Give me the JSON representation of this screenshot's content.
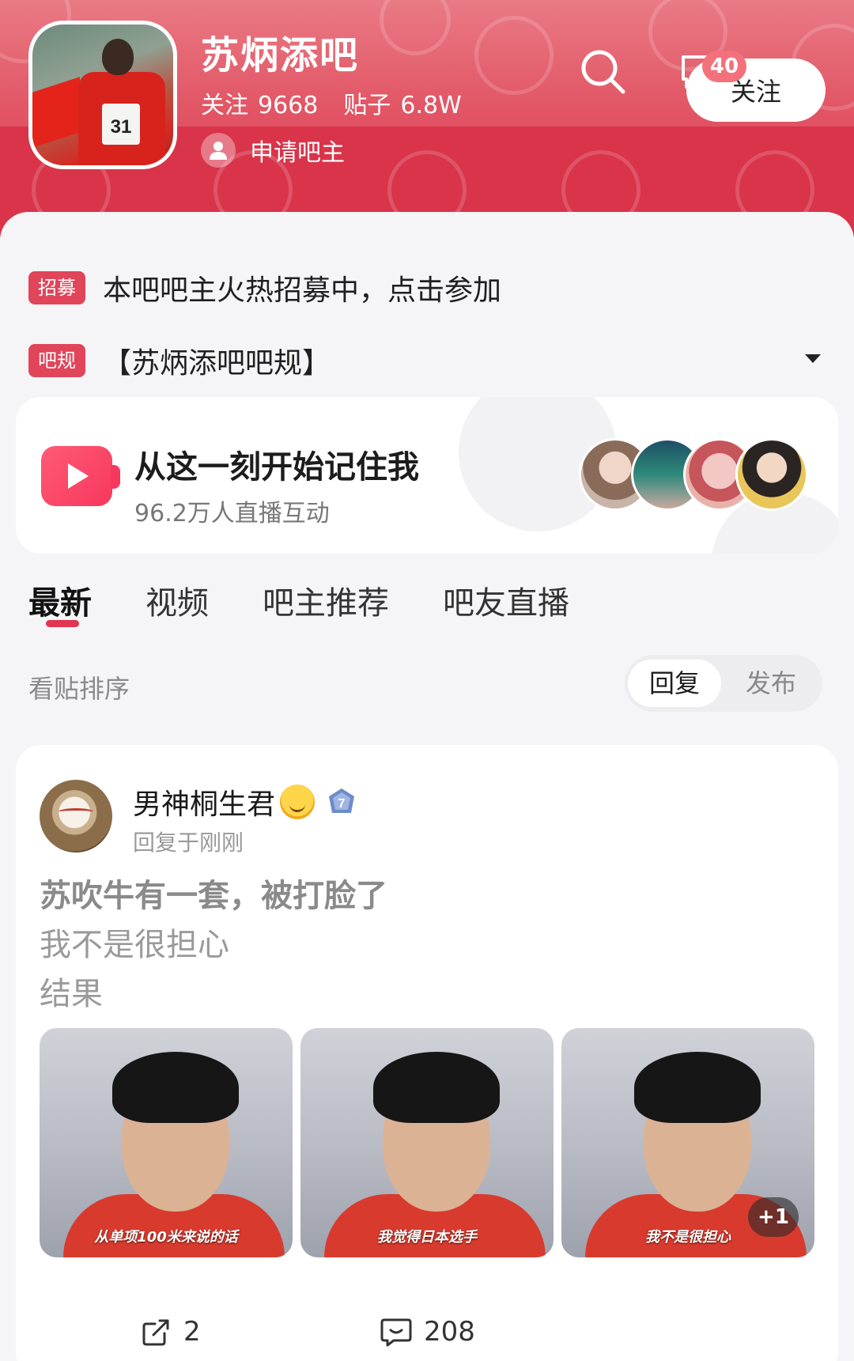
{
  "header": {
    "title": "苏炳添吧",
    "follow_label": "关注",
    "follow_count": "9668",
    "posts_label": "贴子",
    "posts_count": "6.8W",
    "apply_owner": "申请吧主",
    "follow_button": "关注",
    "message_badge": "40",
    "avatar_bib": "31",
    "colors": {
      "header": "#dc3d50",
      "accent": "#e0455a"
    }
  },
  "notices": {
    "recruit_tag": "招募",
    "recruit_text": "本吧吧主火热招募中，点击参加",
    "rules_tag": "吧规",
    "rules_text": "【苏炳添吧吧规】"
  },
  "live": {
    "title": "从这一刻开始记住我",
    "subtitle": "96.2万人直播互动"
  },
  "tabs": [
    "最新",
    "视频",
    "吧主推荐",
    "吧友直播"
  ],
  "sort": {
    "label": "看贴排序",
    "options": [
      "回复",
      "发布"
    ],
    "selected": "回复"
  },
  "post": {
    "username": "男神桐生君",
    "level": "7",
    "time": "回复于刚刚",
    "title": "苏吹牛有一套，被打脸了",
    "lines": [
      "我不是很担心",
      "结果"
    ],
    "image_captions": [
      "从单项100米来说的话",
      "我觉得日本选手",
      "我不是很担心"
    ],
    "more_images": "+1",
    "share_count": "2",
    "comment_count": "208"
  }
}
